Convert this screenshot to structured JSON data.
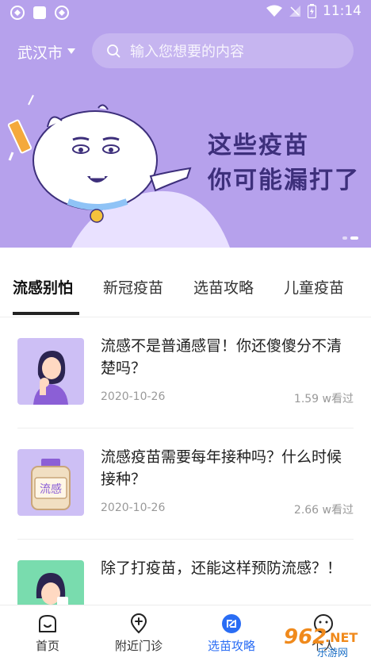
{
  "status_bar": {
    "time": "11:14"
  },
  "header": {
    "city": "武汉市",
    "search_placeholder": "输入您想要的内容"
  },
  "banner": {
    "title_lines": [
      "这些疫苗",
      "你可能漏打了"
    ],
    "page_count": 2,
    "active_page": 2
  },
  "tabs": [
    {
      "label": "流感别怕",
      "active": true
    },
    {
      "label": "新冠疫苗",
      "active": false
    },
    {
      "label": "选苗攻略",
      "active": false
    },
    {
      "label": "儿童疫苗",
      "active": false
    }
  ],
  "articles": [
    {
      "title": "流感不是普通感冒！你还傻傻分不清楚吗？",
      "date": "2020-10-26",
      "views": "1.59 w看过",
      "thumb_icon": "sick-woman-illustration"
    },
    {
      "title": "流感疫苗需要每年接种吗？什么时候接种？",
      "date": "2020-10-26",
      "views": "2.66 w看过",
      "thumb_icon": "vaccine-bottle-illustration",
      "thumb_text": "流感"
    },
    {
      "title": "除了打疫苗，还能这样预防流感？！",
      "date": "",
      "views": "",
      "thumb_icon": "sneezing-woman-illustration"
    }
  ],
  "bottom_nav": [
    {
      "label": "首页",
      "icon": "home-icon",
      "active": false
    },
    {
      "label": "附近门诊",
      "icon": "location-icon",
      "active": false
    },
    {
      "label": "选苗攻略",
      "icon": "vaccine-guide-icon",
      "active": true
    },
    {
      "label": "个人",
      "icon": "profile-icon",
      "active": false
    }
  ],
  "watermark": {
    "brand": "962",
    "suffix": ".NET",
    "subtitle": "乐游网"
  },
  "colors": {
    "hero_bg": "#b6a1ec",
    "banner_text": "#3d2f7b",
    "active_nav": "#2a6df4"
  }
}
